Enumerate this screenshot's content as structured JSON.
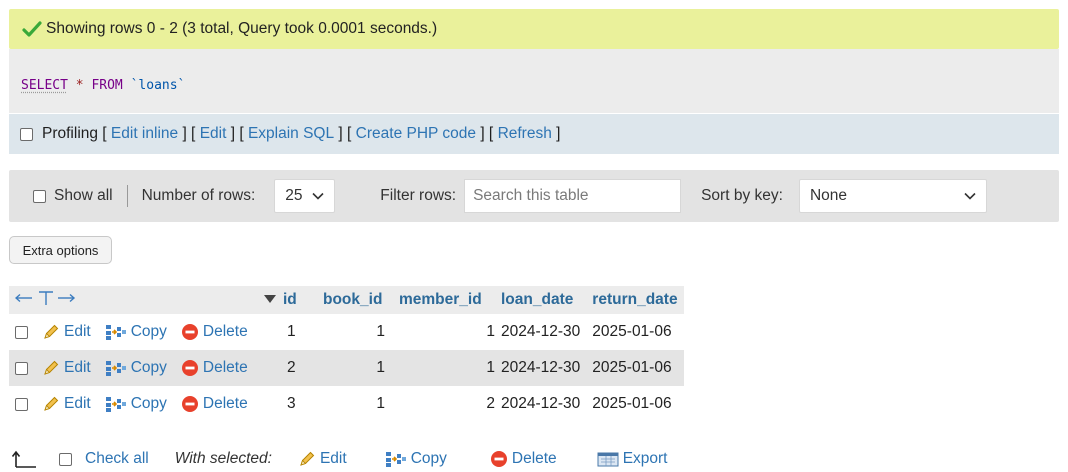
{
  "message": {
    "text": "Showing rows 0 - 2 (3 total, Query took 0.0001 seconds.)"
  },
  "sql": {
    "select": "SELECT",
    "star": "*",
    "from": "FROM",
    "table": "`loans`"
  },
  "profiling": {
    "label": "Profiling",
    "links": [
      "Edit inline",
      "Edit",
      "Explain SQL",
      "Create PHP code",
      "Refresh"
    ]
  },
  "navigation": {
    "show_all": "Show all",
    "rows_label": "Number of rows:",
    "rows_value": "25",
    "filter_label": "Filter rows:",
    "filter_placeholder": "Search this table",
    "sort_label": "Sort by key:",
    "sort_value": "None"
  },
  "extra_options": "Extra options",
  "table": {
    "columns": [
      "id",
      "book_id",
      "member_id",
      "loan_date",
      "return_date"
    ],
    "actions": {
      "edit": "Edit",
      "copy": "Copy",
      "delete": "Delete"
    },
    "rows": [
      {
        "id": "1",
        "book_id": "1",
        "member_id": "1",
        "loan_date": "2024-12-30",
        "return_date": "2025-01-06"
      },
      {
        "id": "2",
        "book_id": "1",
        "member_id": "1",
        "loan_date": "2024-12-30",
        "return_date": "2025-01-06"
      },
      {
        "id": "3",
        "book_id": "1",
        "member_id": "2",
        "loan_date": "2024-12-30",
        "return_date": "2025-01-06"
      }
    ]
  },
  "footer": {
    "check_all": "Check all",
    "with_selected": "With selected:",
    "edit": "Edit",
    "copy": "Copy",
    "delete": "Delete",
    "export": "Export"
  },
  "icons": {
    "success": "check-icon",
    "edit": "pencil-icon",
    "copy": "copy-icon",
    "delete": "delete-icon",
    "export": "export-icon",
    "sort": "sort-desc-icon",
    "arrows": "column-arrows-icon",
    "select_arrow": "arrow-up-left-icon"
  },
  "colors": {
    "success_bg": "#eaf19b",
    "link": "#2d74b3",
    "header_text": "#2d6a99",
    "delete_red": "#e8412c"
  }
}
